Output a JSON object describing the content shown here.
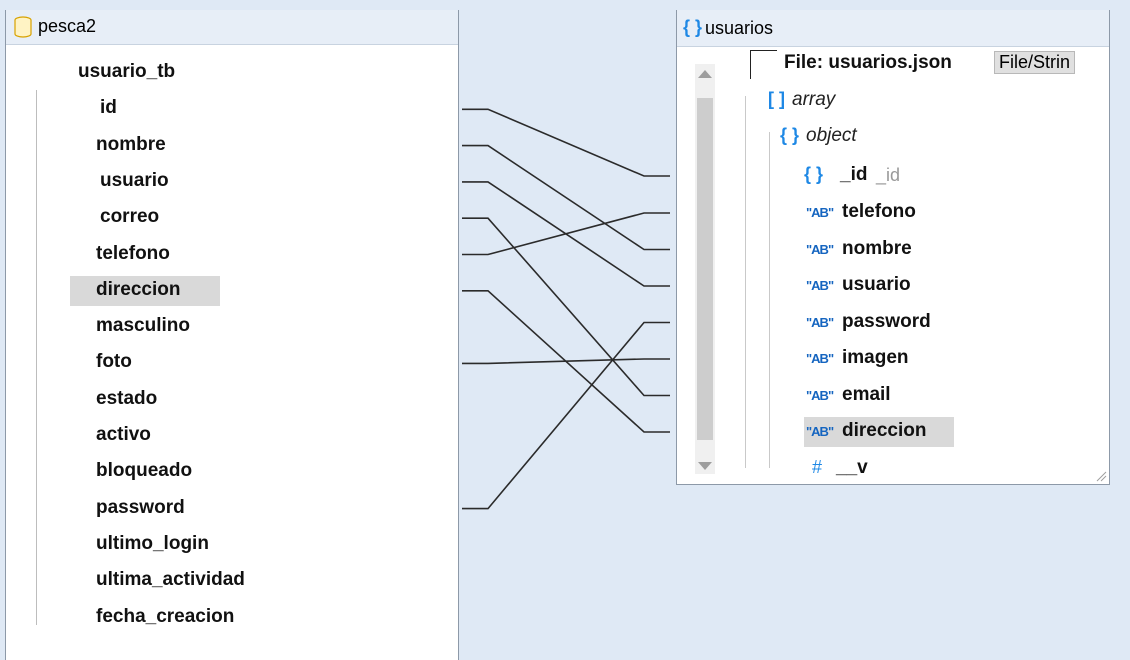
{
  "source": {
    "title": "pesca2",
    "table": "usuario_tb",
    "fields": [
      {
        "label": "id",
        "key": "pk"
      },
      {
        "label": "nombre",
        "key": "none"
      },
      {
        "label": "usuario",
        "key": "unique"
      },
      {
        "label": "correo",
        "key": "unique"
      },
      {
        "label": "telefono",
        "key": "none"
      },
      {
        "label": "direccion",
        "key": "none",
        "selected": true
      },
      {
        "label": "masculino",
        "key": "none"
      },
      {
        "label": "foto",
        "key": "none"
      },
      {
        "label": "estado",
        "key": "none"
      },
      {
        "label": "activo",
        "key": "none"
      },
      {
        "label": "bloqueado",
        "key": "none"
      },
      {
        "label": "password",
        "key": "none"
      },
      {
        "label": "ultimo_login",
        "key": "none"
      },
      {
        "label": "ultima_actividad",
        "key": "none"
      },
      {
        "label": "fecha_creacion",
        "key": "none"
      }
    ]
  },
  "target": {
    "title": "usuarios",
    "file_label": "File: usuarios.json",
    "file_button": "File/Strin",
    "array_label": "array",
    "object_label": "object",
    "id_label": "_id",
    "id_sub": "_id",
    "fields": [
      {
        "label": "telefono"
      },
      {
        "label": "nombre"
      },
      {
        "label": "usuario"
      },
      {
        "label": "password"
      },
      {
        "label": "imagen"
      },
      {
        "label": "email"
      },
      {
        "label": "direccion",
        "selected": true
      }
    ],
    "version_field": "__v",
    "number_glyph": "#",
    "string_glyph": "\"AB\""
  },
  "mappings": [
    {
      "from": "id",
      "to": "_id"
    },
    {
      "from": "nombre",
      "to": "nombre"
    },
    {
      "from": "usuario",
      "to": "usuario"
    },
    {
      "from": "correo",
      "to": "email"
    },
    {
      "from": "telefono",
      "to": "telefono"
    },
    {
      "from": "direccion",
      "to": "direccion"
    },
    {
      "from": "foto",
      "to": "imagen"
    },
    {
      "from": "password",
      "to": "password"
    }
  ],
  "colors": {
    "connected_port": "#16706f",
    "accent": "#1e88e5",
    "pk_key": "#e53935",
    "unique_key": "#7cb342"
  }
}
